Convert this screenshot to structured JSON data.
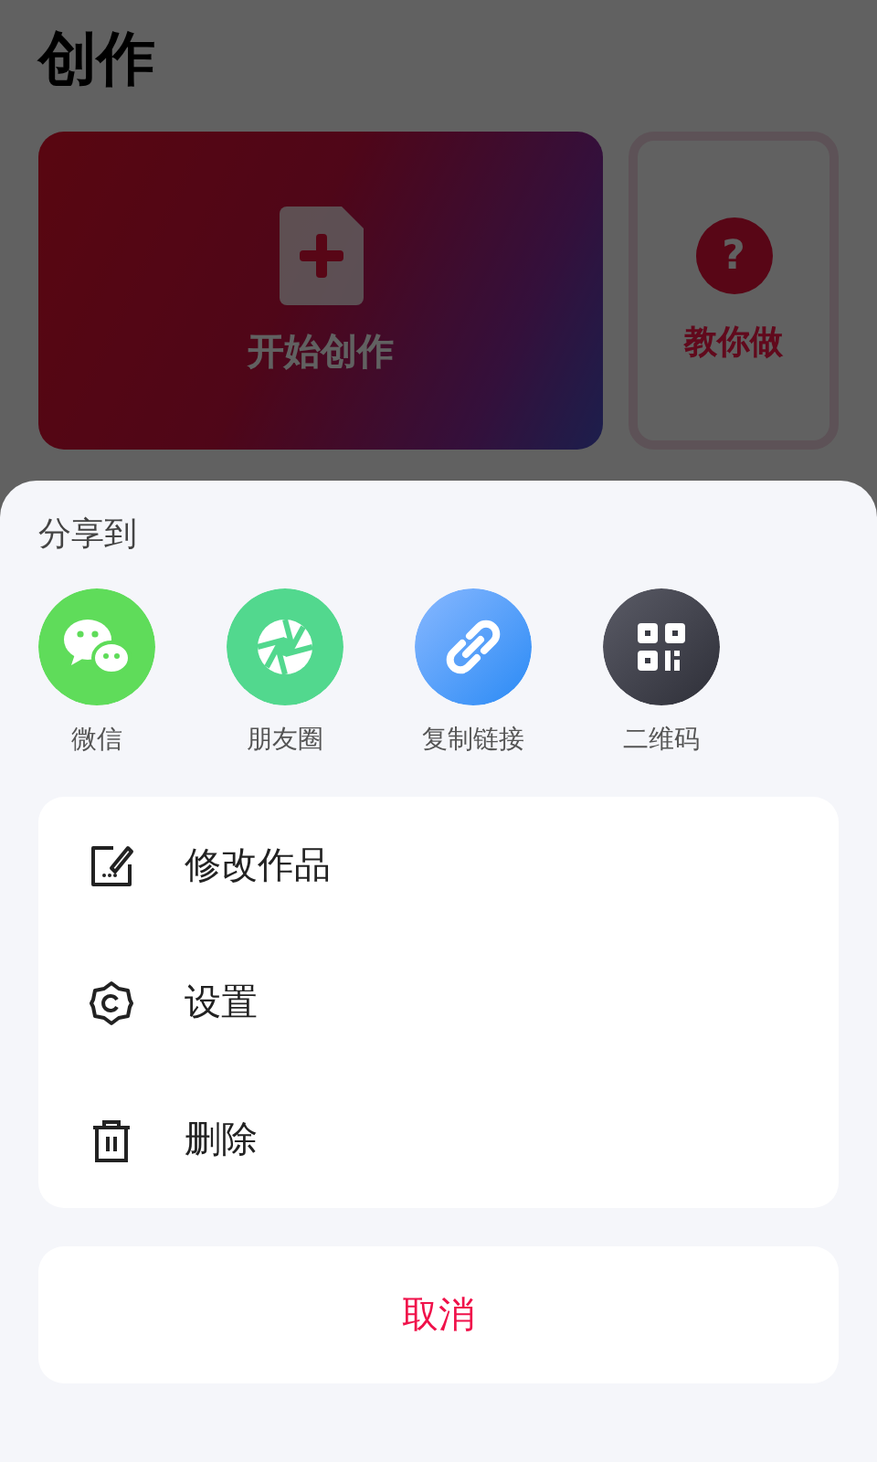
{
  "page": {
    "title": "创作",
    "create_card": {
      "label": "开始创作"
    },
    "tutorial_card": {
      "icon_text": "?",
      "label": "教你做"
    }
  },
  "share_sheet": {
    "heading": "分享到",
    "targets": [
      {
        "kind": "wechat",
        "label": "微信"
      },
      {
        "kind": "moments",
        "label": "朋友圈"
      },
      {
        "kind": "link",
        "label": "复制链接"
      },
      {
        "kind": "qrcode",
        "label": "二维码"
      }
    ],
    "actions": [
      {
        "kind": "edit",
        "label": "修改作品"
      },
      {
        "kind": "settings",
        "label": "设置"
      },
      {
        "kind": "delete",
        "label": "删除"
      }
    ],
    "cancel": "取消"
  }
}
